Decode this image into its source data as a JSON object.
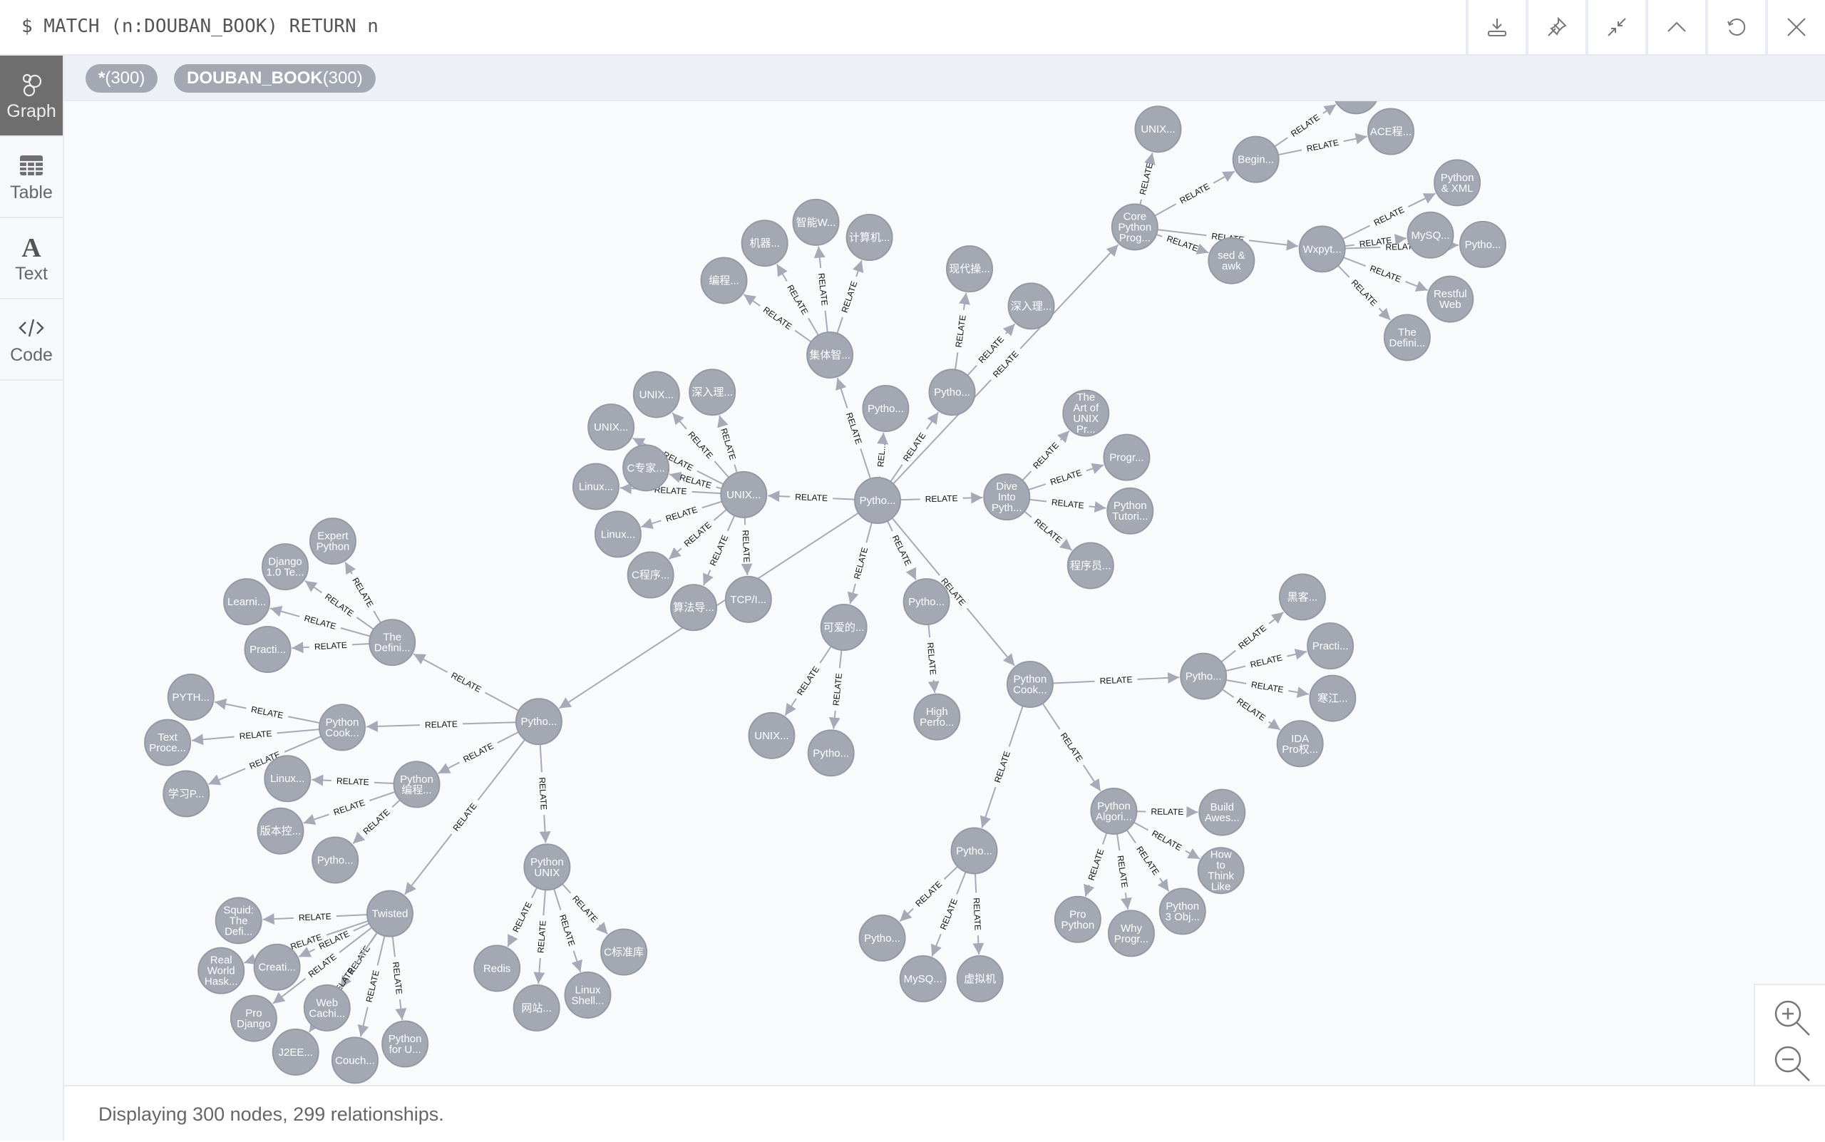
{
  "query": "$ MATCH (n:DOUBAN_BOOK) RETURN n",
  "toolbar": {
    "buttons": [
      {
        "name": "download-button",
        "icon": "download-icon"
      },
      {
        "name": "pin-button",
        "icon": "pin-icon"
      },
      {
        "name": "collapse-button",
        "icon": "collapse-icon"
      },
      {
        "name": "up-button",
        "icon": "chevron-up-icon"
      },
      {
        "name": "rerun-button",
        "icon": "refresh-icon"
      },
      {
        "name": "close-button",
        "icon": "close-icon"
      }
    ]
  },
  "sidebar": {
    "items": [
      {
        "label": "Graph",
        "icon": "graph-icon",
        "active": true
      },
      {
        "label": "Table",
        "icon": "table-icon",
        "active": false
      },
      {
        "label": "Text",
        "icon": "text-icon",
        "active": false
      },
      {
        "label": "Code",
        "icon": "code-icon",
        "active": false
      }
    ]
  },
  "labels": {
    "all": {
      "name": "*",
      "count": "(300)"
    },
    "douban": {
      "name": "DOUBAN_BOOK",
      "count": "(300)"
    }
  },
  "graph": {
    "node_color": "#a4a8b3",
    "edge_color": "#a5aab6",
    "relationship_type": "RELATE",
    "nodes": {
      "c": [
        "Pytho..."
      ],
      "unix": [
        "UNIX..."
      ],
      "pyL": [
        "Pytho..."
      ],
      "core": [
        "Core",
        "Python",
        "Prog..."
      ],
      "dive": [
        "Dive",
        "Into",
        "Pyth..."
      ],
      "cookM": [
        "Python",
        "Cook..."
      ],
      "jiti": [
        "集体智..."
      ],
      "pyA": [
        "Pytho..."
      ],
      "pyB": [
        "Pytho..."
      ],
      "keai": [
        "可爱的..."
      ],
      "pyC": [
        "Pytho..."
      ],
      "tcp": [
        "TCP/I..."
      ],
      "suanfa": [
        "算法导..."
      ],
      "bc": [
        "编程..."
      ],
      "jq": [
        "机器..."
      ],
      "zn": [
        "智能W..."
      ],
      "jsj": [
        "计算机..."
      ],
      "xd": [
        "现代操..."
      ],
      "srl1": [
        "深入理..."
      ],
      "u1": [
        "UNIX..."
      ],
      "srl2": [
        "深入理..."
      ],
      "u2": [
        "UNIX..."
      ],
      "czj": [
        "C专家..."
      ],
      "lx1": [
        "Linux..."
      ],
      "lx2": [
        "Linux..."
      ],
      "ccx": [
        "C程序..."
      ],
      "artunix": [
        "The",
        "Art of",
        "UNIX",
        "Pr..."
      ],
      "progr": [
        "Progr..."
      ],
      "pytut": [
        "Python",
        "Tutori..."
      ],
      "cxy": [
        "程序员..."
      ],
      "unix3": [
        "UNIX..."
      ],
      "pyD": [
        "Pytho..."
      ],
      "high": [
        "High",
        "Perfo..."
      ],
      "u4": [
        "UNIX..."
      ],
      "begin": [
        "Begin..."
      ],
      "ace": [
        "ACE程..."
      ],
      "topn": [
        ""
      ],
      "sed": [
        "sed &",
        "awk"
      ],
      "wx": [
        "Wxpyt..."
      ],
      "pyxml": [
        "Python",
        "& XML"
      ],
      "mysq1": [
        "MySQ..."
      ],
      "pyE": [
        "Pytho..."
      ],
      "rest": [
        "Restful",
        "Web"
      ],
      "defi1": [
        "The",
        "Defini..."
      ],
      "pyF": [
        "Pytho..."
      ],
      "hk": [
        "黑客..."
      ],
      "prac1": [
        "Practi..."
      ],
      "hj": [
        "寒江..."
      ],
      "ida": [
        "IDA",
        "Pro权..."
      ],
      "algo": [
        "Python",
        "Algori..."
      ],
      "build": [
        "Build",
        "Awes..."
      ],
      "how": [
        "How",
        "to",
        "Think",
        "Like"
      ],
      "py3": [
        "Python",
        "3 Obj..."
      ],
      "why": [
        "Why",
        "Progr..."
      ],
      "pro": [
        "Pro",
        "Python"
      ],
      "pyG": [
        "Pytho..."
      ],
      "pyH": [
        "Pytho..."
      ],
      "mysq2": [
        "MySQ..."
      ],
      "xnj": [
        "虚拟机"
      ],
      "defi2": [
        "The",
        "Defini..."
      ],
      "expert": [
        "Expert",
        "Python"
      ],
      "django": [
        "Django",
        "1.0 Te..."
      ],
      "learn": [
        "Learni..."
      ],
      "prac2": [
        "Practi..."
      ],
      "cookL": [
        "Python",
        "Cook..."
      ],
      "pyth": [
        "PYTH..."
      ],
      "textp": [
        "Text",
        "Proce..."
      ],
      "xx": [
        "学习P..."
      ],
      "pybc": [
        "Python",
        "编程..."
      ],
      "lx3": [
        "Linux..."
      ],
      "bbk": [
        "版本控..."
      ],
      "pyI": [
        "Pytho..."
      ],
      "twisted": [
        "Twisted"
      ],
      "squid": [
        "Squid:",
        "The",
        "Defi..."
      ],
      "real": [
        "Real",
        "World",
        "Hask..."
      ],
      "creati": [
        "Creati..."
      ],
      "prodj": [
        "Pro",
        "Django"
      ],
      "webc": [
        "Web",
        "Cachi..."
      ],
      "j2ee": [
        "J2EE..."
      ],
      "couch": [
        "Couch..."
      ],
      "pyforu": [
        "Python",
        "for U..."
      ],
      "pyunix": [
        "Python",
        "UNIX"
      ],
      "redis": [
        "Redis"
      ],
      "wz": [
        "网站..."
      ],
      "lshell": [
        "Linux",
        "Shell..."
      ],
      "cbzk": [
        "C标准库"
      ]
    },
    "edges": [
      [
        "c",
        "unix",
        "RELATE"
      ],
      [
        "c",
        "dive",
        "RELATE"
      ],
      [
        "c",
        "jiti",
        "RELATE"
      ],
      [
        "c",
        "pyA",
        "REL..."
      ],
      [
        "c",
        "pyB",
        "RELATE"
      ],
      [
        "c",
        "core",
        "RELATE"
      ],
      [
        "c",
        "keai",
        "RELATE"
      ],
      [
        "c",
        "pyC",
        "RELATE"
      ],
      [
        "c",
        "cookM",
        "RELATE"
      ],
      [
        "c",
        "pyL",
        ""
      ],
      [
        "unix",
        "srl1",
        "RELATE"
      ],
      [
        "unix",
        "u1",
        "RELATE"
      ],
      [
        "unix",
        "u2",
        "RELATE"
      ],
      [
        "unix",
        "czj",
        "RELATE"
      ],
      [
        "unix",
        "lx1",
        "RELATE"
      ],
      [
        "unix",
        "lx2",
        "RELATE"
      ],
      [
        "unix",
        "ccx",
        "RELATE"
      ],
      [
        "unix",
        "suanfa",
        "RELATE"
      ],
      [
        "unix",
        "tcp",
        "RELATE"
      ],
      [
        "jiti",
        "bc",
        "RELATE"
      ],
      [
        "jiti",
        "jq",
        "RELATE"
      ],
      [
        "jiti",
        "zn",
        "RELATE"
      ],
      [
        "jiti",
        "jsj",
        "RELATE"
      ],
      [
        "pyB",
        "xd",
        "RELATE"
      ],
      [
        "pyB",
        "srl2",
        "RELATE"
      ],
      [
        "dive",
        "artunix",
        "RELATE"
      ],
      [
        "dive",
        "progr",
        "RELATE"
      ],
      [
        "dive",
        "pytut",
        "RELATE"
      ],
      [
        "dive",
        "cxy",
        "RELATE"
      ],
      [
        "keai",
        "u4",
        "RELATE"
      ],
      [
        "keai",
        "pyD",
        "RELATE"
      ],
      [
        "pyC",
        "high",
        "RELATE"
      ],
      [
        "core",
        "unix3",
        "RELATE"
      ],
      [
        "core",
        "begin",
        "RELATE"
      ],
      [
        "core",
        "sed",
        "RELATE"
      ],
      [
        "core",
        "wx",
        "RELATE"
      ],
      [
        "begin",
        "topn",
        "RELATE"
      ],
      [
        "begin",
        "ace",
        "RELATE"
      ],
      [
        "wx",
        "pyxml",
        "RELATE"
      ],
      [
        "wx",
        "mysq1",
        "RELATE"
      ],
      [
        "wx",
        "pyE",
        "RELATE"
      ],
      [
        "wx",
        "rest",
        "RELATE"
      ],
      [
        "wx",
        "defi1",
        "RELATE"
      ],
      [
        "cookM",
        "pyF",
        "RELATE"
      ],
      [
        "cookM",
        "algo",
        "RELATE"
      ],
      [
        "cookM",
        "pyG",
        "RELATE"
      ],
      [
        "pyF",
        "hk",
        "RELATE"
      ],
      [
        "pyF",
        "prac1",
        "RELATE"
      ],
      [
        "pyF",
        "hj",
        "RELATE"
      ],
      [
        "pyF",
        "ida",
        "RELATE"
      ],
      [
        "algo",
        "build",
        "RELATE"
      ],
      [
        "algo",
        "how",
        "RELATE"
      ],
      [
        "algo",
        "py3",
        "RELATE"
      ],
      [
        "algo",
        "why",
        "RELATE"
      ],
      [
        "algo",
        "pro",
        "RELATE"
      ],
      [
        "pyG",
        "pyH",
        "RELATE"
      ],
      [
        "pyG",
        "mysq2",
        "RELATE"
      ],
      [
        "pyG",
        "xnj",
        "RELATE"
      ],
      [
        "pyL",
        "defi2",
        "RELATE"
      ],
      [
        "pyL",
        "cookL",
        "RELATE"
      ],
      [
        "pyL",
        "pybc",
        "RELATE"
      ],
      [
        "pyL",
        "twisted",
        "RELATE"
      ],
      [
        "pyL",
        "pyunix",
        "RELATE"
      ],
      [
        "defi2",
        "expert",
        "RELATE"
      ],
      [
        "defi2",
        "django",
        "RELATE"
      ],
      [
        "defi2",
        "learn",
        "RELATE"
      ],
      [
        "defi2",
        "prac2",
        "RELATE"
      ],
      [
        "cookL",
        "pyth",
        "RELATE"
      ],
      [
        "cookL",
        "textp",
        "RELATE"
      ],
      [
        "cookL",
        "xx",
        "RELATE"
      ],
      [
        "pybc",
        "lx3",
        "RELATE"
      ],
      [
        "pybc",
        "bbk",
        "RELATE"
      ],
      [
        "pybc",
        "pyI",
        "RELATE"
      ],
      [
        "twisted",
        "squid",
        "RELATE"
      ],
      [
        "twisted",
        "real",
        "RELATE"
      ],
      [
        "twisted",
        "creati",
        "RELATE"
      ],
      [
        "twisted",
        "prodj",
        "RELATE"
      ],
      [
        "twisted",
        "webc",
        "RELATE"
      ],
      [
        "twisted",
        "j2ee",
        "RELATE"
      ],
      [
        "twisted",
        "couch",
        "RELATE"
      ],
      [
        "twisted",
        "pyforu",
        "RELATE"
      ],
      [
        "pyunix",
        "redis",
        "RELATE"
      ],
      [
        "pyunix",
        "wz",
        "RELATE"
      ],
      [
        "pyunix",
        "lshell",
        "RELATE"
      ],
      [
        "pyunix",
        "cbzk",
        "RELATE"
      ]
    ]
  },
  "status": "Displaying 300 nodes, 299 relationships.",
  "zoom_controls": {
    "zoom_in": "zoom-in-icon",
    "zoom_out": "zoom-out-icon"
  }
}
